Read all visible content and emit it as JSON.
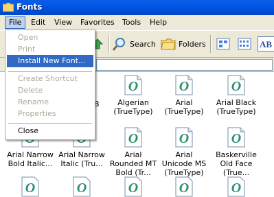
{
  "window": {
    "title": "Fonts"
  },
  "menubar": {
    "items": [
      "File",
      "Edit",
      "View",
      "Favorites",
      "Tools",
      "Help"
    ]
  },
  "toolbar": {
    "search_label": "Search",
    "folders_label": "Folders",
    "abc_label": "AB"
  },
  "file_menu": {
    "items": [
      "Open",
      "Print",
      "Install New Font...",
      "Create Shortcut",
      "Delete",
      "Rename",
      "Properties",
      "Close"
    ]
  },
  "fonts": [
    {
      "label": "Algerian (TrueType)"
    },
    {
      "label": "Arial (TrueType)"
    },
    {
      "label": "Arial Black (TrueType)"
    },
    {
      "label": "Arial Narrow Bold Italic..."
    },
    {
      "label": "Arial Narrow Italic (Tru..."
    },
    {
      "label": "Arial Rounded MT Bold (Tr..."
    },
    {
      "label": "Arial Unicode MS (TrueType)"
    },
    {
      "label": "Baskerville Old Face (True..."
    }
  ],
  "partial_labels": {
    "b_fragment": "B"
  },
  "colors": {
    "titlebar": "#0054e3",
    "menu_highlight": "#316ac5",
    "font_icon": "#2c8f6c"
  }
}
